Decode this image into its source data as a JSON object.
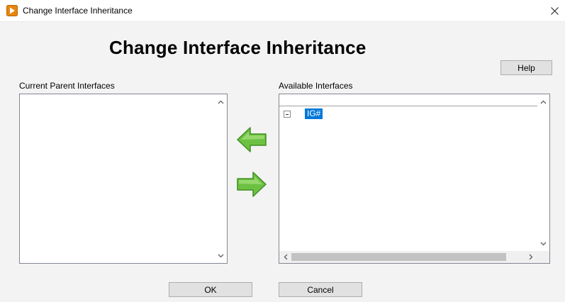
{
  "window": {
    "title": "Change Interface Inheritance",
    "icon": "labview-app-icon"
  },
  "heading": "Change Interface Inheritance",
  "help_button": "Help",
  "current_parents": {
    "label": "Current Parent Interfaces",
    "items": []
  },
  "available": {
    "label": "Available Interfaces",
    "tree": [
      {
        "label": "IG#",
        "expanded": true,
        "selected": true
      }
    ]
  },
  "transfer": {
    "add_icon": "arrow-left-icon",
    "remove_icon": "arrow-right-icon"
  },
  "footer": {
    "ok_label": "OK",
    "cancel_label": "Cancel"
  },
  "colors": {
    "selection": "#0078d7",
    "arrow_green": "#6cc142",
    "app_icon": "#e8860c"
  }
}
